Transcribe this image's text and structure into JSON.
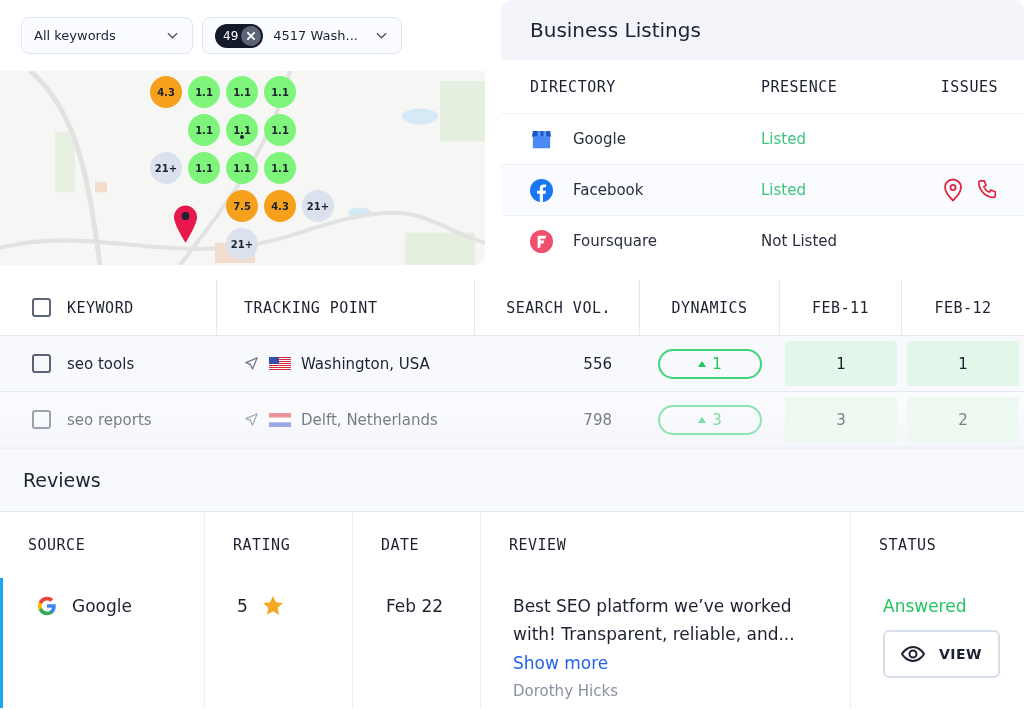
{
  "filters": [
    {
      "label": "All keywords"
    },
    {
      "badge": "49",
      "label": "4517 Wash..."
    }
  ],
  "map": {
    "kind": "picture",
    "grid": [
      [
        {
          "kind": "rank",
          "value": "4.3",
          "color": "#f5a11c",
          "marker": false
        },
        {
          "kind": "rank",
          "value": "1.1",
          "color": "#7ef57a",
          "marker": false
        },
        {
          "kind": "rank",
          "value": "1.1",
          "color": "#7ef57a",
          "marker": false
        },
        {
          "kind": "rank",
          "value": "1.1",
          "color": "#7ef57a",
          "marker": false
        }
      ],
      [
        {
          "kind": "blank"
        },
        {
          "kind": "rank",
          "value": "1.1",
          "color": "#7ef57a",
          "marker": false
        },
        {
          "kind": "rank",
          "value": "1.1",
          "color": "#7ef57a",
          "marker": true
        },
        {
          "kind": "rank",
          "value": "1.1",
          "color": "#7ef57a",
          "marker": false
        }
      ],
      [
        {
          "kind": "rank",
          "value": "21+",
          "color": "#dbe2ee",
          "marker": false
        },
        {
          "kind": "rank",
          "value": "1.1",
          "color": "#7ef57a",
          "marker": false
        },
        {
          "kind": "rank",
          "value": "1.1",
          "color": "#7ef57a",
          "marker": false
        },
        {
          "kind": "rank",
          "value": "1.1",
          "color": "#7ef57a",
          "marker": false
        }
      ],
      [
        {
          "kind": "blank"
        },
        {
          "kind": "blank"
        },
        {
          "kind": "rank",
          "value": "7.5",
          "color": "#f5a11c",
          "marker": false
        },
        {
          "kind": "rank",
          "value": "4.3",
          "color": "#f5a11c",
          "marker": false
        },
        {
          "kind": "rank",
          "value": "21+",
          "color": "#dbe2ee",
          "marker": false
        }
      ],
      [
        {
          "kind": "blank"
        },
        {
          "kind": "blank"
        },
        {
          "kind": "rank",
          "value": "21+",
          "color": "#dbe2ee",
          "marker": false
        }
      ]
    ]
  },
  "listings": {
    "title": "Business Listings",
    "columns": [
      "DIRECTORY",
      "PRESENCE",
      "ISSUES"
    ],
    "rows": [
      {
        "kind": "gmb",
        "name": "Google",
        "presence": "Listed",
        "listed": true,
        "issues": []
      },
      {
        "kind": "facebook",
        "name": "Facebook",
        "presence": "Listed",
        "listed": true,
        "issues": [
          {
            "kind": "location"
          },
          {
            "kind": "phone"
          }
        ]
      },
      {
        "kind": "foursquare",
        "name": "Foursquare",
        "presence": "Not Listed",
        "listed": false,
        "issues": []
      }
    ]
  },
  "keywords": {
    "columns": [
      "KEYWORD",
      "TRACKING POINT",
      "SEARCH VOL.",
      "DYNAMICS",
      "FEB-11",
      "FEB-12"
    ],
    "header_checked": false,
    "rows": [
      {
        "checked": false,
        "dimmed": false,
        "keyword": "seo tools",
        "flag": {
          "kind": "us"
        },
        "location": "Washington, USA",
        "volume": "556",
        "dynamics": "1",
        "positions": [
          "1",
          "1"
        ]
      },
      {
        "checked": false,
        "dimmed": true,
        "keyword": "seo reports",
        "flag": {
          "kind": "nl"
        },
        "location": "Delft, Netherlands",
        "volume": "798",
        "dynamics": "3",
        "positions": [
          "3",
          "2"
        ]
      }
    ]
  },
  "reviews": {
    "title": "Reviews",
    "columns": [
      "SOURCE",
      "RATING",
      "DATE",
      "REVIEW",
      "STATUS"
    ],
    "rows": [
      {
        "source": "Google",
        "rating": "5",
        "date": "Feb 22",
        "text": "Best SEO platform we’ve worked with! Transparent, reliable, and...",
        "more": "Show more",
        "author": "Dorothy Hicks",
        "status": "Answered",
        "action": "VIEW"
      }
    ]
  }
}
